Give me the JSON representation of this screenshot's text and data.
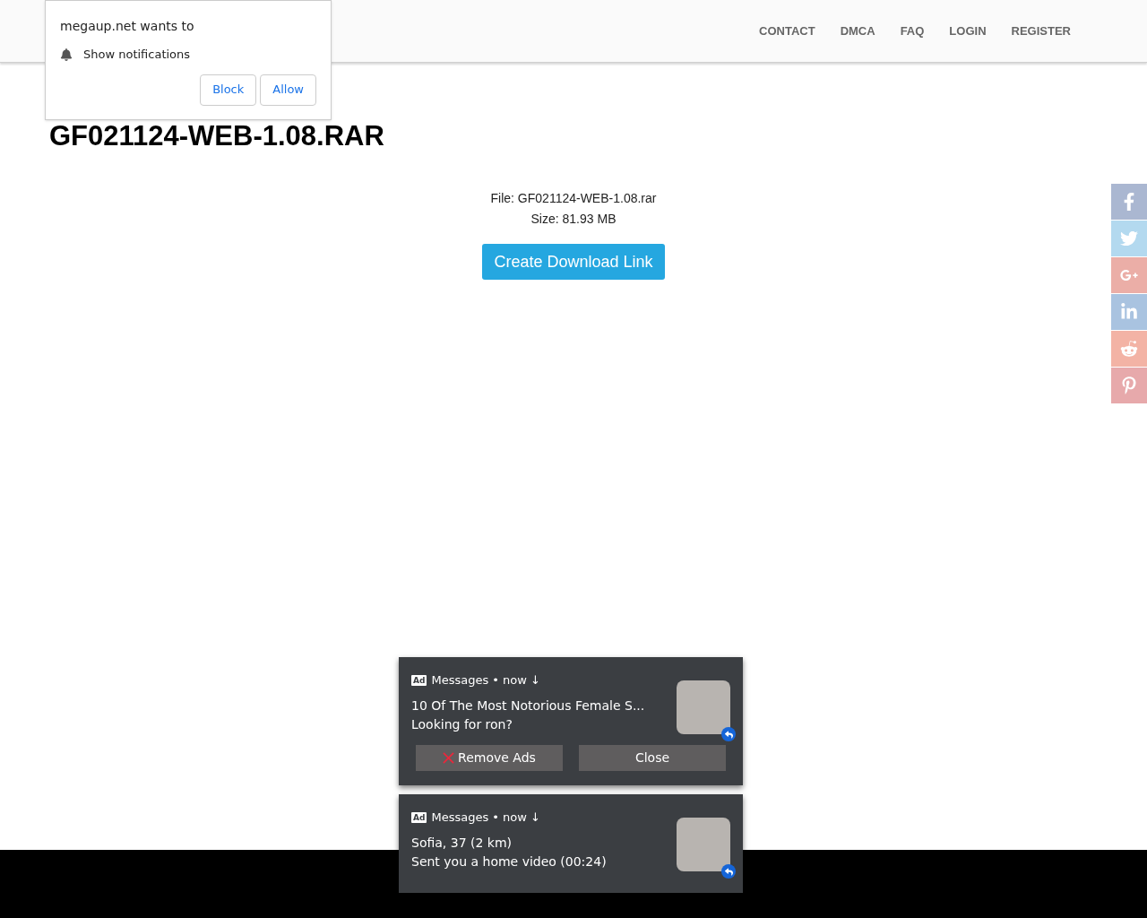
{
  "nav": {
    "links": [
      "CONTACT",
      "DMCA",
      "FAQ",
      "LOGIN",
      "REGISTER"
    ]
  },
  "permission_prompt": {
    "title": "megaup.net wants to",
    "request": "Show notifications",
    "buttons": [
      "Block",
      "Allow"
    ]
  },
  "page": {
    "title": "GF021124-WEB-1.08.RAR",
    "file": "File: GF021124-WEB-1.08.rar",
    "size": "Size: 81.93 MB",
    "button": "Create Download Link"
  },
  "share_bar": [
    {
      "color": "#aab7d1"
    },
    {
      "color": "#b3d9ef"
    },
    {
      "color": "#ebaea7"
    },
    {
      "color": "#a9c3e0"
    },
    {
      "color": "#f3b3a5"
    },
    {
      "color": "#e7a9ab"
    }
  ],
  "notifications": [
    {
      "badge": "Ad",
      "source": "Messages • now ↓",
      "title": "10 Of The Most Notorious Female S...",
      "body": "Looking for ron?",
      "buttons": [
        "Remove Ads",
        "Close"
      ]
    },
    {
      "badge": "Ad",
      "source": "Messages • now ↓",
      "title": "Sofia, 37 (2 km)",
      "body": "Sent you a home video (00:24)"
    }
  ]
}
